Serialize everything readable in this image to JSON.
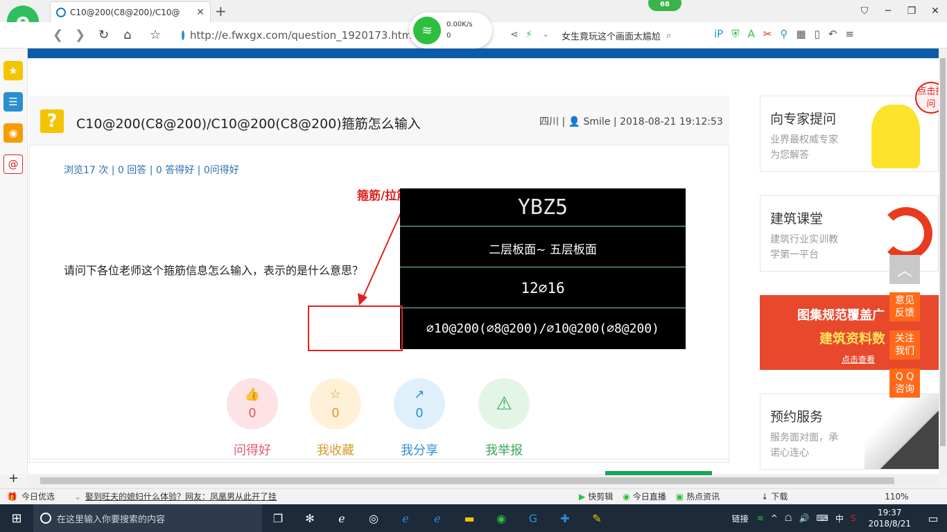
{
  "browser": {
    "tab_title": "C10@200(C8@200)/C10@",
    "tab_close": "✕",
    "new_tab": "+",
    "window_controls": [
      "⛉",
      "─",
      "❐",
      "✕"
    ],
    "url": "http://e.fwxgx.com/question_1920173.htm",
    "search_text": "女生竟玩这个画面太尴尬",
    "network": {
      "speed": "0.00K/s",
      "count": "0"
    },
    "badge": "68"
  },
  "question": {
    "title": "C10@200(C8@200)/C10@200(C8@200)箍筋怎么输入",
    "region": "四川",
    "author": "Smile",
    "datetime": "2018-08-21 19:12:53",
    "stats": "浏览17 次 | 0 回答 | 0 答得好 | 0问得好",
    "text": "请问下各位老师这个箍筋信息怎么输入，表示的是什么意思？",
    "annotation": "箍筋/拉筋",
    "cad": {
      "row1": "YBZ5",
      "row2": "二层板面~ 五层板面",
      "row3": "12⌀16",
      "row4": "⌀10@200(⌀8@200)/⌀10@200(⌀8@200)"
    }
  },
  "actions": [
    {
      "count": "0",
      "label": "问得好",
      "color": "#e05a6a",
      "bg": "#fde3e6",
      "icon": "thumbs-up-icon",
      "glyph": "👍"
    },
    {
      "count": "0",
      "label": "我收藏",
      "color": "#d99a2a",
      "bg": "#fff1d8",
      "icon": "star-icon",
      "glyph": "☆"
    },
    {
      "count": "0",
      "label": "我分享",
      "color": "#2e8fd4",
      "bg": "#dff0fb",
      "icon": "share-icon",
      "glyph": "↗"
    },
    {
      "count": "",
      "label": "我举报",
      "color": "#3aa75a",
      "bg": "#e2f5e6",
      "icon": "warning-icon",
      "glyph": "⚠"
    }
  ],
  "sidebar": {
    "cards": [
      {
        "title": "向专家提问",
        "line1": "业界最权威专家",
        "line2": "为您解答"
      },
      {
        "title": "建筑课堂",
        "line1": "建筑行业实训教",
        "line2": "学第一平台"
      },
      {
        "title": "预约服务",
        "line1": "服务面对面，承",
        "line2": "诺心连心"
      }
    ],
    "promo": {
      "line1": "图集规范覆盖广",
      "line2": "建筑资料数",
      "line3": "点击查看"
    },
    "float_buttons": [
      "意见\n反馈",
      "关注\n我们",
      "Q Q\n咨询"
    ],
    "hint": "点击提问"
  },
  "statusbar": {
    "left": "今日优选",
    "news": "娶到旺夫的媳妇什么体验？网友：凤凰男从此开了挂",
    "items": [
      "快剪辑",
      "今日直播",
      "热点资讯",
      "下载"
    ],
    "zoom": "110%"
  },
  "taskbar": {
    "search_placeholder": "在这里输入你要搜索的内容",
    "tray_link": "链接",
    "ime": "中",
    "time": "19:37",
    "date": "2018/8/21"
  }
}
